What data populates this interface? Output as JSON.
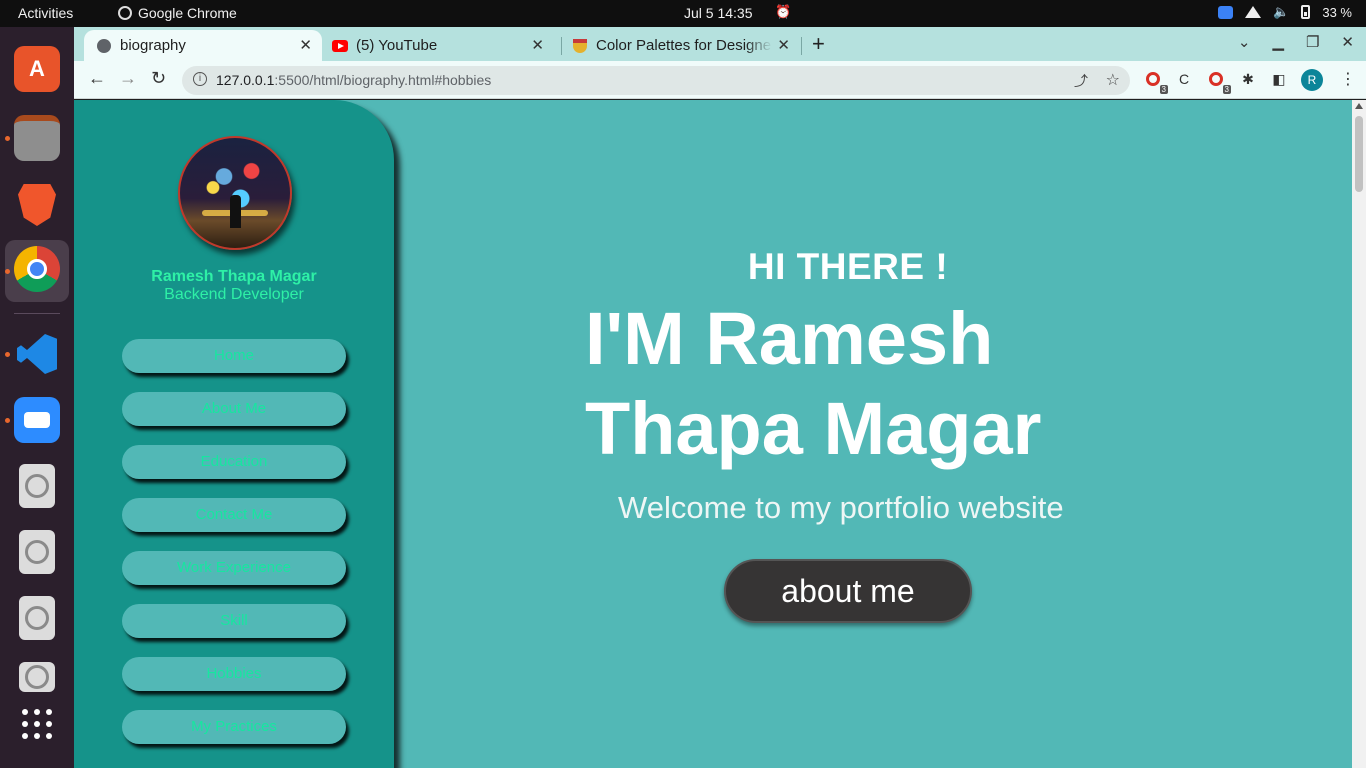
{
  "system": {
    "activities": "Activities",
    "app_name": "Google Chrome",
    "clock": "Jul 5  14:35",
    "battery": "33 %"
  },
  "browser": {
    "tabs": [
      {
        "title": "biography",
        "active": true
      },
      {
        "title": "(5) YouTube",
        "active": false
      },
      {
        "title": "Color Palettes for Designers",
        "active": false
      }
    ],
    "url_host": "127.0.0.1",
    "url_path": ":5500/html/biography.html#hobbies",
    "profile_initial": "R",
    "ext_badge_1": "3",
    "ext_badge_2": "3"
  },
  "sidebar": {
    "name": "Ramesh Thapa Magar",
    "role": "Backend Developer",
    "nav": [
      {
        "label": "Home"
      },
      {
        "label": "About Me"
      },
      {
        "label": "Education"
      },
      {
        "label": "Contact Me"
      },
      {
        "label": "Work Experience"
      },
      {
        "label": "Skill"
      },
      {
        "label": "Hobbies"
      },
      {
        "label": "My Practices"
      }
    ]
  },
  "hero": {
    "greeting": "HI THERE !",
    "headline_line1": "I'M Ramesh",
    "headline_line2": "Thapa Magar",
    "subtitle": "Welcome to my portfolio website",
    "cta_label": "about me"
  },
  "colors": {
    "page_bg": "#52b8b6",
    "sidebar_bg": "#15938a",
    "nav_text": "#17e6a0",
    "cta_bg": "#363434"
  }
}
